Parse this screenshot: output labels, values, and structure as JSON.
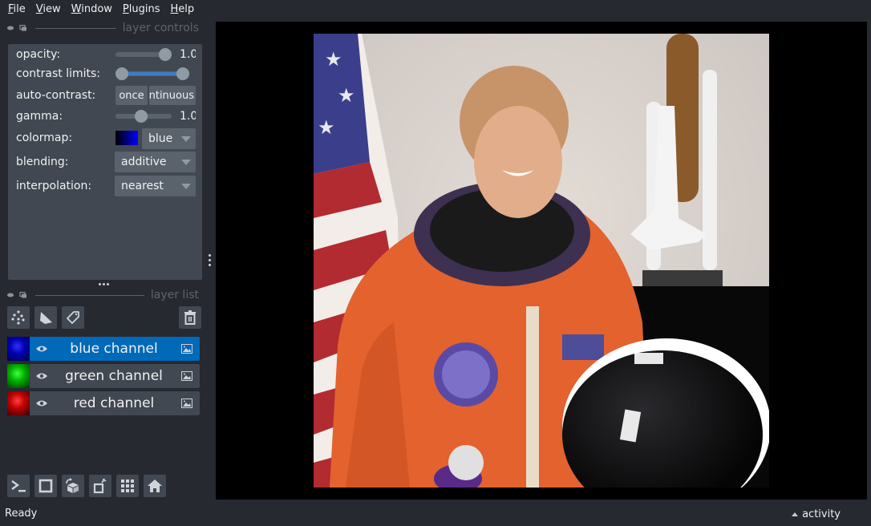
{
  "menubar": {
    "items": [
      {
        "label": "File",
        "mnemonic": "F",
        "rest": "ile"
      },
      {
        "label": "View",
        "mnemonic": "V",
        "rest": "iew"
      },
      {
        "label": "Window",
        "mnemonic": "W",
        "rest": "indow"
      },
      {
        "label": "Plugins",
        "mnemonic": "P",
        "rest": "lugins"
      },
      {
        "label": "Help",
        "mnemonic": "H",
        "rest": "elp"
      }
    ]
  },
  "layer_controls": {
    "title": "layer controls",
    "opacity": {
      "label": "opacity:",
      "value": "1.0",
      "fraction": 1.0
    },
    "contrast_limits": {
      "label": "contrast limits:",
      "low_fraction": 0.0,
      "high_fraction": 1.0
    },
    "auto_contrast": {
      "label": "auto-contrast:",
      "once_label": "once",
      "continuous_label": "continuous"
    },
    "gamma": {
      "label": "gamma:",
      "value": "1.0",
      "fraction": 0.5
    },
    "colormap": {
      "label": "colormap:",
      "value": "blue",
      "swatch_start": "#000000",
      "swatch_end": "#0000ff"
    },
    "blending": {
      "label": "blending:",
      "value": "additive"
    },
    "interpolation": {
      "label": "interpolation:",
      "value": "nearest"
    }
  },
  "layer_list": {
    "title": "layer list",
    "tool_buttons": [
      "new-points-layer",
      "new-shapes-layer",
      "new-labels-layer"
    ],
    "delete_button": "delete-layer",
    "layers": [
      {
        "name": "blue channel",
        "visible": true,
        "selected": true,
        "type": "image",
        "color": "#0000ff"
      },
      {
        "name": "green channel",
        "visible": true,
        "selected": false,
        "type": "image",
        "color": "#00ff00"
      },
      {
        "name": "red channel",
        "visible": true,
        "selected": false,
        "type": "image",
        "color": "#ff0000"
      }
    ]
  },
  "viewer_buttons": [
    "console",
    "ndisplay-toggle",
    "roll-dimensions",
    "transpose-dimensions",
    "grid-mode",
    "reset-view"
  ],
  "canvas": {
    "image_description": "Astronaut portrait in orange flight suit with US flag and shuttle model"
  },
  "status": {
    "text": "Ready",
    "activity_label": "activity"
  },
  "colors": {
    "background": "#262930",
    "panel": "#414851",
    "widget": "#5a626c",
    "selected": "#0069b8",
    "text": "#f0f1f2"
  }
}
